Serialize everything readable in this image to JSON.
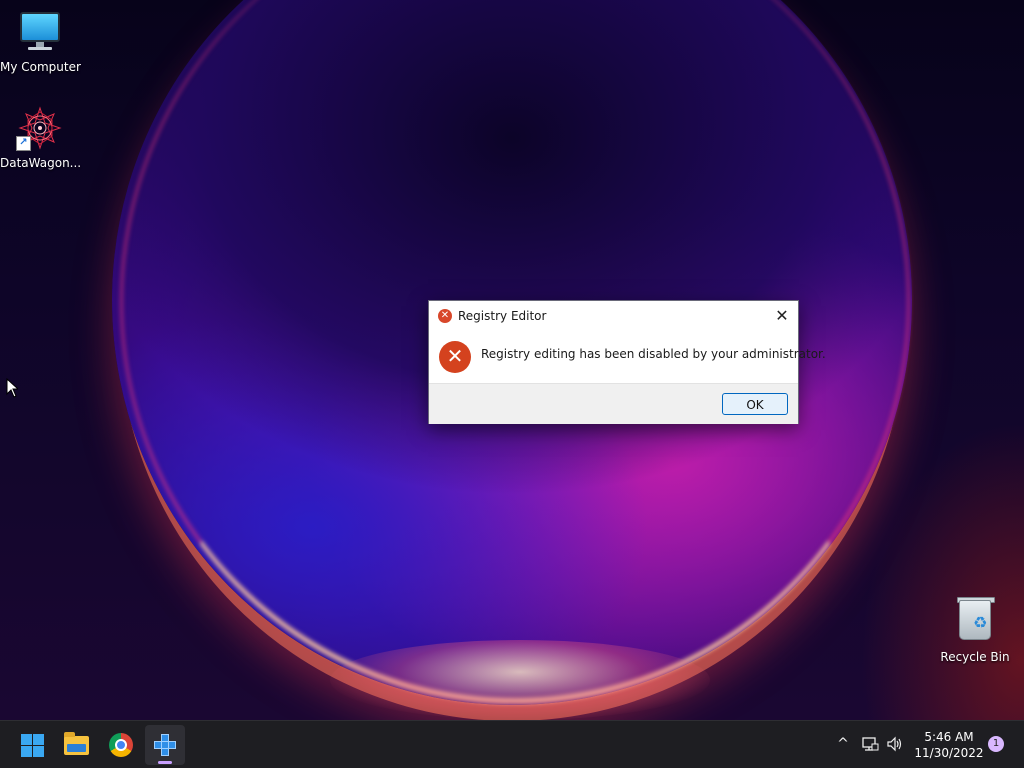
{
  "desktop": {
    "icons": [
      {
        "label": "My Computer",
        "icon": "monitor-icon"
      },
      {
        "label": "DataWagon...",
        "icon": "datawagon-shortcut-icon"
      },
      {
        "label": "Recycle Bin",
        "icon": "recycle-bin-icon"
      }
    ]
  },
  "dialog": {
    "title": "Registry Editor",
    "close_glyph": "✕",
    "error_glyph": "✕",
    "message": "Registry editing has been disabled by your administrator.",
    "ok_label": "OK",
    "accent_color": "#d4421e"
  },
  "taskbar": {
    "apps": [
      {
        "name": "start",
        "icon": "windows-logo-icon"
      },
      {
        "name": "file-explorer",
        "icon": "folder-icon"
      },
      {
        "name": "chrome",
        "icon": "chrome-icon"
      },
      {
        "name": "registry-editor",
        "icon": "regedit-icon",
        "active": true
      }
    ],
    "tray": {
      "chevron": "^",
      "time": "5:46 AM",
      "date": "11/30/2022",
      "notifications": "1"
    }
  }
}
